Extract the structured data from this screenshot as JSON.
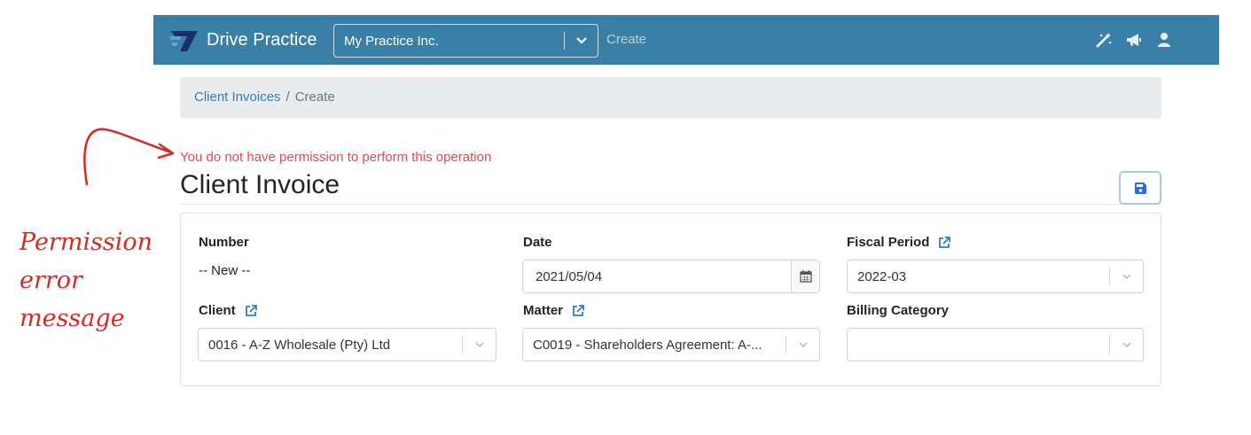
{
  "navbar": {
    "brand": "Drive Practice",
    "practice_value": "My Practice Inc.",
    "create_label": "Create",
    "icons": [
      "magic-wand-icon",
      "megaphone-icon",
      "user-icon"
    ]
  },
  "breadcrumb": {
    "parent": "Client Invoices",
    "separator": "/",
    "current": "Create"
  },
  "annotation": {
    "lines": [
      "Permission",
      "error",
      "message"
    ]
  },
  "error_message": "You do not have permission to perform this operation",
  "page_title": "Client Invoice",
  "form": {
    "number_label": "Number",
    "number_value": "-- New --",
    "date_label": "Date",
    "date_value": "2021/05/04",
    "fiscal_label": "Fiscal Period",
    "fiscal_value": "2022-03",
    "client_label": "Client",
    "client_value": "0016 - A-Z Wholesale (Pty) Ltd",
    "matter_label": "Matter",
    "matter_value": "C0019 - Shareholders Agreement: A-...",
    "billing_label": "Billing Category",
    "billing_value": ""
  },
  "colors": {
    "navbar": "#3a7fa6",
    "error": "#dc4a57",
    "annotation": "#d32b25",
    "link": "#2f7ec1"
  }
}
